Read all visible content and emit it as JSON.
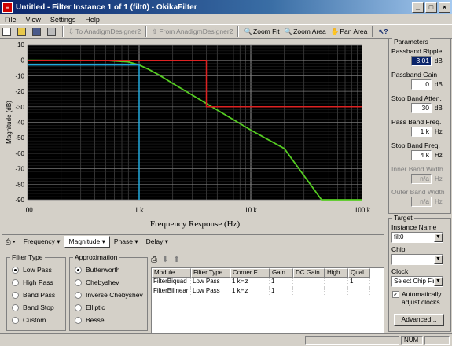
{
  "window": {
    "title": "Untitled - Filter Instance 1 of 1 (filt0) - OkikaFilter",
    "minimize": "_",
    "maximize": "□",
    "close": "×"
  },
  "menu": [
    "File",
    "View",
    "Settings",
    "Help"
  ],
  "toolbar": {
    "to_anadigm": "To AnadigmDesigner2",
    "from_anadigm": "From AnadigmDesigner2",
    "zoom_fit": "Zoom Fit",
    "zoom_area": "Zoom Area",
    "pan_area": "Pan Area",
    "help_icon": "help-pointer-icon"
  },
  "chart_data": {
    "type": "line",
    "xlabel": "Frequency Response (Hz)",
    "ylabel": "Magnitude (dB)",
    "xscale": "log",
    "xlim": [
      100,
      100000
    ],
    "ylim": [
      -90,
      10
    ],
    "x_ticks": [
      "100",
      "1 k",
      "10 k",
      "100 k"
    ],
    "y_ticks": [
      "10",
      "0",
      "-10",
      "-20",
      "-30",
      "-40",
      "-50",
      "-60",
      "-70",
      "-80",
      "-90"
    ],
    "grid": true,
    "background": "#000000",
    "series": [
      {
        "color": "#55cc22",
        "x": [
          100,
          500,
          800,
          1000,
          1200,
          1500,
          2000,
          3000,
          5000,
          10000,
          20000,
          43000,
          100000
        ],
        "y": [
          0,
          -0.1,
          -1,
          -3,
          -5.6,
          -9.4,
          -14.9,
          -22.5,
          -32.1,
          -45,
          -57,
          -90,
          -90
        ]
      },
      {
        "color": "#dd2222",
        "x": [
          100,
          4000,
          4000,
          100000
        ],
        "y": [
          0,
          0,
          -30,
          -30
        ]
      },
      {
        "color": "#22aadd",
        "x": [
          100,
          1000,
          1000
        ],
        "y": [
          -3,
          -3,
          -90
        ]
      }
    ]
  },
  "tabs": [
    "Frequency",
    "Magnitude",
    "Phase",
    "Delay"
  ],
  "filter_type": {
    "title": "Filter Type",
    "options": [
      "Low Pass",
      "High Pass",
      "Band Pass",
      "Band Stop",
      "Custom"
    ],
    "selected": 0
  },
  "approximation": {
    "title": "Approximation",
    "options": [
      "Butterworth",
      "Chebyshev",
      "Inverse Chebyshev",
      "Elliptic",
      "Bessel"
    ],
    "selected": 0
  },
  "table": {
    "columns": [
      "Module",
      "Filter Type",
      "Corner F...",
      "Gain",
      "DC Gain",
      "High ...",
      "Qual..."
    ],
    "rows": [
      [
        "FilterBiquad",
        "Low Pass",
        "1 kHz",
        "1",
        "",
        "",
        "1"
      ],
      [
        "FilterBilinear",
        "Low Pass",
        "1 kHz",
        "1",
        "",
        "",
        ""
      ]
    ]
  },
  "parameters": {
    "title": "Parameters",
    "passband_ripple": {
      "label": "Passband Ripple",
      "value": "3.01",
      "unit": "dB"
    },
    "passband_gain": {
      "label": "Passband Gain",
      "value": "0",
      "unit": "dB"
    },
    "stopband_atten": {
      "label": "Stop Band Atten.",
      "value": "30",
      "unit": "dB"
    },
    "passband_freq": {
      "label": "Pass Band Freq.",
      "value": "1 k",
      "unit": "Hz"
    },
    "stopband_freq": {
      "label": "Stop Band Freq.",
      "value": "4 k",
      "unit": "Hz"
    },
    "inner_band": {
      "label": "Inner Band Width",
      "value": "n/a",
      "unit": "Hz"
    },
    "outer_band": {
      "label": "Outer Band Width",
      "value": "n/a",
      "unit": "Hz"
    }
  },
  "target": {
    "title": "Target",
    "instance_label": "Instance Name",
    "instance_value": "filt0",
    "chip_label": "Chip",
    "chip_value": "",
    "clock_label": "Clock",
    "clock_value": "Select Chip First",
    "auto_adjust": "Automatically adjust clocks.",
    "advanced": "Advanced..."
  },
  "status": {
    "num": "NUM"
  }
}
